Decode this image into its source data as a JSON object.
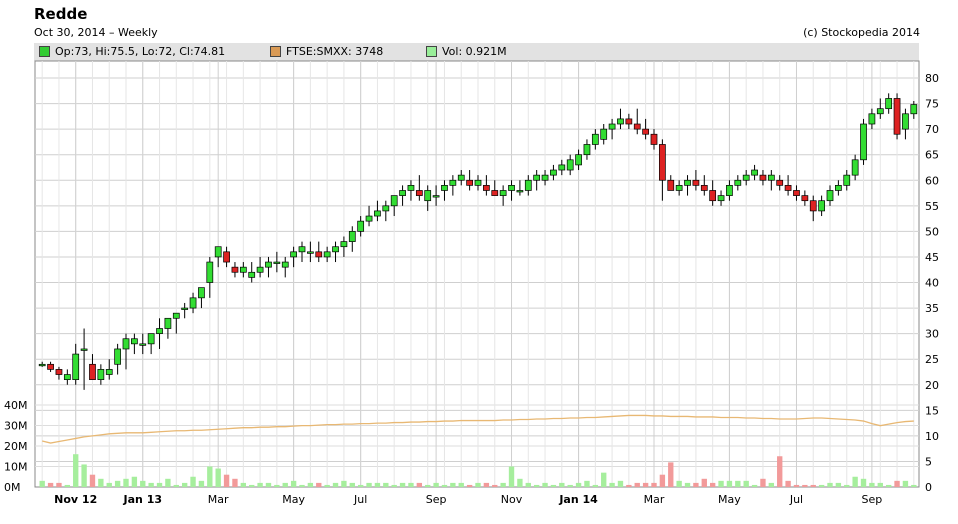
{
  "header": {
    "title": "Redde",
    "subtitle": "Oct 30, 2014  –  Weekly",
    "copyright": "(c) Stockopedia 2014"
  },
  "legend": [
    {
      "label": "Op:73, Hi:75.5, Lo:72, Cl:74.81",
      "color": "#33cc33"
    },
    {
      "label": "FTSE:SMXX: 3748",
      "color": "#d99a55"
    },
    {
      "label": "Vol: 0.921M",
      "color": "#99ee99"
    }
  ],
  "colors": {
    "up": "#33dd33",
    "down": "#dd2222",
    "wick": "#000000",
    "ftse": "#e8b873",
    "vol_up": "#a6ee9d",
    "vol_down": "#f29a9a",
    "grid": "#cfcfcf"
  },
  "chart_data": {
    "type": "candlestick",
    "interval": "Weekly",
    "price_axis": {
      "ticks": [
        "0",
        "5",
        "10",
        "15",
        "20",
        "25",
        "30",
        "35",
        "40",
        "45",
        "50",
        "55",
        "60",
        "65",
        "70",
        "75",
        "80"
      ],
      "range": [
        0,
        80
      ]
    },
    "volume_axis": {
      "ticks": [
        "0M",
        "10M",
        "20M",
        "30M",
        "40M"
      ],
      "range": [
        0,
        40
      ]
    },
    "x_axis": {
      "ticks": [
        {
          "label": "Nov 12",
          "week": 4,
          "bold": true
        },
        {
          "label": "Jan 13",
          "week": 12,
          "bold": true
        },
        {
          "label": "Mar",
          "week": 21,
          "bold": false
        },
        {
          "label": "May",
          "week": 30,
          "bold": false
        },
        {
          "label": "Jul",
          "week": 38,
          "bold": false
        },
        {
          "label": "Sep",
          "week": 47,
          "bold": false
        },
        {
          "label": "Nov",
          "week": 56,
          "bold": false
        },
        {
          "label": "Jan 14",
          "week": 64,
          "bold": true
        },
        {
          "label": "Mar",
          "week": 73,
          "bold": false
        },
        {
          "label": "May",
          "week": 82,
          "bold": false
        },
        {
          "label": "Jul",
          "week": 90,
          "bold": false
        },
        {
          "label": "Sep",
          "week": 99,
          "bold": false
        }
      ]
    },
    "ohlc": [
      [
        24,
        24.5,
        23.5,
        24
      ],
      [
        24,
        24.5,
        22.5,
        23
      ],
      [
        23,
        23.5,
        21,
        22
      ],
      [
        21,
        23,
        20,
        22
      ],
      [
        21,
        28,
        20,
        26
      ],
      [
        27,
        31,
        19,
        27
      ],
      [
        24,
        26,
        21,
        21
      ],
      [
        21,
        24,
        20,
        23
      ],
      [
        22,
        25,
        21,
        23
      ],
      [
        24,
        28,
        22,
        27
      ],
      [
        27,
        30,
        23,
        29
      ],
      [
        28,
        30,
        26,
        29
      ],
      [
        28,
        30,
        26,
        28
      ],
      [
        28,
        30,
        26,
        30
      ],
      [
        30,
        33,
        27,
        31
      ],
      [
        31,
        33,
        29,
        33
      ],
      [
        33,
        34,
        30,
        34
      ],
      [
        35,
        36,
        33,
        35
      ],
      [
        35,
        38,
        34,
        37
      ],
      [
        37,
        39,
        35,
        39
      ],
      [
        40,
        45,
        37,
        44
      ],
      [
        45,
        47,
        43,
        47
      ],
      [
        46,
        47,
        43,
        44
      ],
      [
        43,
        44,
        41,
        42
      ],
      [
        42,
        44,
        41,
        43
      ],
      [
        41,
        44,
        40,
        42
      ],
      [
        42,
        45,
        41,
        43
      ],
      [
        43,
        45,
        41,
        44
      ],
      [
        44,
        46,
        42,
        44
      ],
      [
        43,
        45,
        41,
        44
      ],
      [
        45,
        47,
        43,
        46
      ],
      [
        46,
        48,
        44,
        47
      ],
      [
        46,
        48,
        44,
        46
      ],
      [
        46,
        48,
        44,
        45
      ],
      [
        45,
        47,
        44,
        46
      ],
      [
        46,
        48,
        44,
        47
      ],
      [
        47,
        49,
        45,
        48
      ],
      [
        48,
        51,
        46,
        50
      ],
      [
        50,
        53,
        49,
        52
      ],
      [
        52,
        55,
        51,
        53
      ],
      [
        53,
        56,
        52,
        54
      ],
      [
        54,
        56,
        52,
        55
      ],
      [
        55,
        57,
        53,
        57
      ],
      [
        57,
        59,
        55,
        58
      ],
      [
        58,
        60,
        56,
        59
      ],
      [
        58,
        61,
        56,
        57
      ],
      [
        56,
        59,
        54,
        58
      ],
      [
        57,
        59,
        55,
        57
      ],
      [
        58,
        60,
        56,
        59
      ],
      [
        59,
        61,
        57,
        60
      ],
      [
        60,
        62,
        59,
        61
      ],
      [
        60,
        62,
        58,
        59
      ],
      [
        59,
        61,
        58,
        60
      ],
      [
        59,
        61,
        57,
        58
      ],
      [
        58,
        60,
        57,
        57
      ],
      [
        57,
        59,
        55,
        58
      ],
      [
        58,
        60,
        56,
        59
      ],
      [
        58,
        60,
        57,
        58
      ],
      [
        58,
        61,
        57,
        60
      ],
      [
        60,
        62,
        58,
        61
      ],
      [
        60,
        62,
        59,
        61
      ],
      [
        61,
        63,
        60,
        62
      ],
      [
        62,
        64,
        61,
        63
      ],
      [
        62,
        65,
        61,
        64
      ],
      [
        63,
        66,
        62,
        65
      ],
      [
        65,
        68,
        64,
        67
      ],
      [
        67,
        70,
        66,
        69
      ],
      [
        68,
        71,
        67,
        70
      ],
      [
        70,
        72,
        68,
        71
      ],
      [
        71,
        74,
        70,
        72
      ],
      [
        72,
        73,
        70,
        71
      ],
      [
        71,
        74,
        69,
        70
      ],
      [
        70,
        72,
        68,
        69
      ],
      [
        69,
        70,
        66,
        67
      ],
      [
        67,
        68,
        56,
        60
      ],
      [
        60,
        61,
        58,
        58
      ],
      [
        58,
        60,
        57,
        59
      ],
      [
        59,
        61,
        57,
        60
      ],
      [
        60,
        62,
        58,
        59
      ],
      [
        59,
        61,
        57,
        58
      ],
      [
        58,
        60,
        55,
        56
      ],
      [
        56,
        58,
        55,
        57
      ],
      [
        57,
        60,
        56,
        59
      ],
      [
        59,
        61,
        58,
        60
      ],
      [
        60,
        62,
        59,
        61
      ],
      [
        61,
        63,
        60,
        62
      ],
      [
        61,
        62,
        59,
        60
      ],
      [
        60,
        62,
        58,
        61
      ],
      [
        60,
        61,
        58,
        59
      ],
      [
        59,
        61,
        57,
        58
      ],
      [
        58,
        59,
        56,
        57
      ],
      [
        57,
        58,
        55,
        56
      ],
      [
        56,
        57,
        52,
        54
      ],
      [
        54,
        57,
        53,
        56
      ],
      [
        56,
        59,
        55,
        58
      ],
      [
        58,
        60,
        57,
        59
      ],
      [
        59,
        62,
        58,
        61
      ],
      [
        61,
        65,
        60,
        64
      ],
      [
        64,
        72,
        63,
        71
      ],
      [
        71,
        74,
        70,
        73
      ],
      [
        73,
        76,
        72,
        74
      ],
      [
        74,
        77,
        73,
        76
      ],
      [
        76,
        77,
        68,
        69
      ],
      [
        70,
        74,
        68,
        73
      ],
      [
        73,
        75.5,
        72,
        74.81
      ]
    ],
    "ftse": [
      9,
      8.6,
      8.9,
      9.2,
      9.5,
      9.8,
      10,
      10.2,
      10.4,
      10.5,
      10.6,
      10.6,
      10.6,
      10.7,
      10.8,
      10.9,
      11,
      11,
      11.1,
      11.1,
      11.2,
      11.3,
      11.4,
      11.5,
      11.6,
      11.6,
      11.7,
      11.7,
      11.8,
      11.8,
      11.9,
      12,
      12,
      12.1,
      12.2,
      12.2,
      12.3,
      12.3,
      12.4,
      12.4,
      12.5,
      12.5,
      12.6,
      12.6,
      12.7,
      12.7,
      12.8,
      12.8,
      12.9,
      12.9,
      13,
      13,
      13,
      13,
      13,
      13.1,
      13.1,
      13.2,
      13.2,
      13.3,
      13.3,
      13.4,
      13.4,
      13.5,
      13.5,
      13.6,
      13.6,
      13.7,
      13.8,
      13.9,
      14,
      14,
      14,
      13.9,
      13.9,
      13.8,
      13.8,
      13.8,
      13.7,
      13.7,
      13.7,
      13.6,
      13.6,
      13.6,
      13.5,
      13.5,
      13.4,
      13.4,
      13.3,
      13.3,
      13.3,
      13.4,
      13.5,
      13.5,
      13.4,
      13.3,
      13.2,
      13.1,
      12.9,
      12.4,
      12,
      12.3,
      12.6,
      12.8,
      12.9
    ],
    "volume": [
      3,
      2,
      2,
      1,
      16,
      11,
      6,
      4,
      2,
      3,
      4,
      5,
      3,
      2,
      2,
      4,
      1,
      2,
      5,
      3,
      10,
      9,
      6,
      4,
      2,
      1,
      2,
      2,
      1,
      2,
      3,
      1,
      2,
      2,
      1,
      2,
      3,
      2,
      1,
      2,
      2,
      2,
      1,
      2,
      2,
      2,
      1,
      2,
      1,
      2,
      2,
      1,
      2,
      2,
      1,
      2,
      10,
      4,
      2,
      1,
      2,
      1,
      2,
      1,
      2,
      3,
      1,
      7,
      2,
      3,
      1,
      2,
      2,
      2,
      6,
      12,
      3,
      2,
      2,
      4,
      2,
      3,
      3,
      3,
      3,
      1,
      4,
      2,
      15,
      3,
      1,
      1,
      1,
      1,
      2,
      2,
      1,
      5,
      4,
      2,
      2,
      1,
      3,
      3,
      1
    ]
  }
}
